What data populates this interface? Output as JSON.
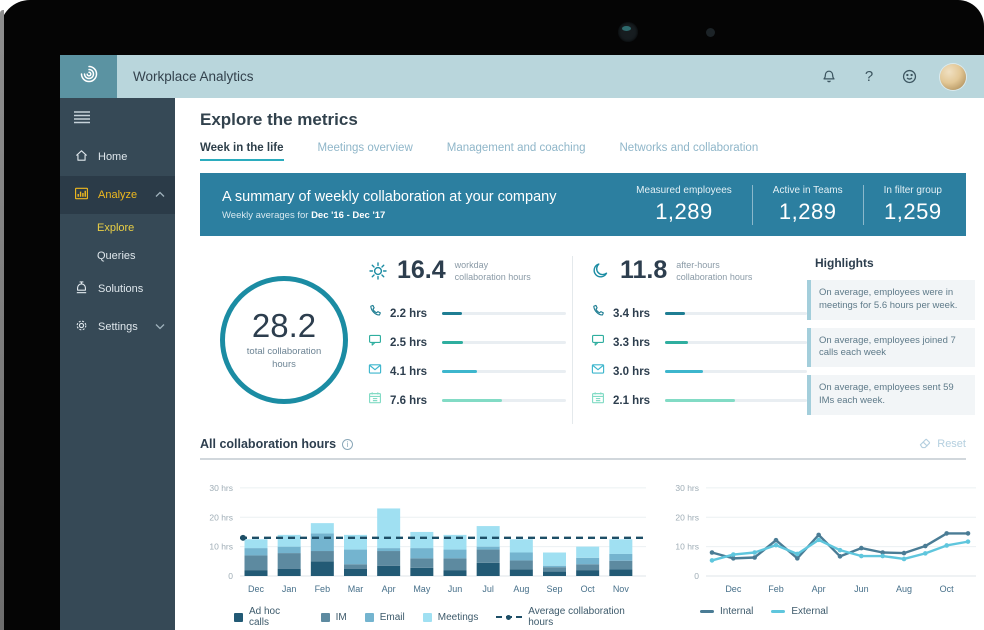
{
  "topbar": {
    "title": "Workplace Analytics",
    "help_label": "?"
  },
  "sidebar": {
    "items": [
      {
        "label": "Home"
      },
      {
        "label": "Analyze"
      },
      {
        "label": "Explore"
      },
      {
        "label": "Queries"
      },
      {
        "label": "Solutions"
      },
      {
        "label": "Settings"
      }
    ],
    "accent_gold": "#efb91f"
  },
  "page": {
    "title": "Explore the metrics",
    "tabs": [
      {
        "label": "Week in the life",
        "active": true
      },
      {
        "label": "Meetings overview",
        "active": false
      },
      {
        "label": "Management and coaching",
        "active": false
      },
      {
        "label": "Networks and collaboration",
        "active": false
      }
    ]
  },
  "banner": {
    "title": "A summary of weekly collaboration at your company",
    "subtitle_prefix": "Weekly averages for",
    "date_range": "Dec '16 - Dec '17",
    "accent": "#2c7fa0",
    "stats": [
      {
        "label": "Measured employees",
        "value": "1,289"
      },
      {
        "label": "Active in Teams",
        "value": "1,289"
      },
      {
        "label": "In filter group",
        "value": "1,259"
      }
    ]
  },
  "summary": {
    "total": {
      "value": "28.2",
      "label": "total collaboration hours"
    },
    "workday": {
      "value": "16.4",
      "label": "workday collaboration hours",
      "rows": [
        {
          "icon": "phone-icon",
          "value": "2.2 hrs",
          "pct": 16,
          "color": "#1f7e93"
        },
        {
          "icon": "im-icon",
          "value": "2.5 hrs",
          "pct": 17,
          "color": "#2fae9f"
        },
        {
          "icon": "email-icon",
          "value": "4.1 hrs",
          "pct": 28,
          "color": "#3db6cd"
        },
        {
          "icon": "meetings-icon",
          "value": "7.6 hrs",
          "pct": 48,
          "color": "#82dbc5"
        }
      ]
    },
    "after_hours": {
      "value": "11.8",
      "label": "after-hours collaboration hours",
      "rows": [
        {
          "icon": "phone-icon",
          "value": "3.4 hrs",
          "pct": 14,
          "color": "#1f7e93"
        },
        {
          "icon": "im-icon",
          "value": "3.3 hrs",
          "pct": 16,
          "color": "#2fae9f"
        },
        {
          "icon": "email-icon",
          "value": "3.0 hrs",
          "pct": 27,
          "color": "#3db6cd"
        },
        {
          "icon": "meetings-icon",
          "value": "2.1 hrs",
          "pct": 49,
          "color": "#82dbc5"
        }
      ]
    }
  },
  "highlights": {
    "title": "Highlights",
    "cards": [
      "On average, employees were in meetings for 5.6 hours per week.",
      "On average, employees joined 7 calls each week",
      "On average, employees sent 59 IMs each week."
    ]
  },
  "section": {
    "title": "All collaboration hours",
    "reset_label": "Reset"
  },
  "chart_data": [
    {
      "type": "bar",
      "stacked": true,
      "title": "All collaboration hours",
      "categories": [
        "Dec",
        "Jan",
        "Feb",
        "Mar",
        "Apr",
        "May",
        "Jun",
        "Jul",
        "Aug",
        "Sep",
        "Oct",
        "Nov"
      ],
      "series": [
        {
          "name": "Ad hoc calls",
          "color": "#225a75",
          "values": [
            2,
            2.5,
            5,
            2.5,
            3.5,
            2.8,
            2,
            4.5,
            2.3,
            1.5,
            2,
            2.2
          ]
        },
        {
          "name": "IM",
          "color": "#5d8aa0",
          "values": [
            5,
            5.3,
            3.5,
            1.5,
            5,
            3.2,
            4,
            4.5,
            3,
            1.5,
            2,
            3
          ]
        },
        {
          "name": "Email",
          "color": "#74b4cf",
          "values": [
            2.5,
            2.2,
            6,
            5,
            1,
            3.5,
            3,
            1,
            2.7,
            0.5,
            2.2,
            2.3
          ]
        },
        {
          "name": "Meetings",
          "color": "#a0e0f2",
          "values": [
            3,
            4,
            3.5,
            5,
            13.5,
            5.5,
            5,
            7,
            4.5,
            4.5,
            3.8,
            5
          ]
        }
      ],
      "average_line": {
        "label": "Average collaboration hours",
        "value": 13,
        "color": "#1d4e66"
      },
      "ylabel": "hrs",
      "ytick_values": [
        0,
        10,
        20,
        30
      ],
      "ytick_labels": [
        "0",
        "10 hrs",
        "20 hrs",
        "30 hrs"
      ],
      "ymax": 32,
      "grid": true,
      "legend_position": "bottom"
    },
    {
      "type": "line",
      "x_labels": [
        "Dec",
        "Feb",
        "Apr",
        "Jun",
        "Aug",
        "Oct"
      ],
      "label_indices": [
        1,
        3,
        5,
        7,
        9,
        11
      ],
      "series": [
        {
          "name": "Internal",
          "color": "#4a7c95",
          "values": [
            8,
            6,
            6.3,
            12.2,
            6,
            14,
            6.7,
            9.5,
            8,
            7.8,
            10.2,
            14.5,
            14.5
          ]
        },
        {
          "name": "External",
          "color": "#5fc6dd",
          "values": [
            5.3,
            7.3,
            8,
            10.5,
            7.5,
            12.3,
            8.8,
            6.8,
            6.8,
            5.8,
            7.7,
            10.4,
            11.7
          ]
        }
      ],
      "ytick_values": [
        0,
        10,
        20,
        30
      ],
      "ytick_labels": [
        "0",
        "10 hrs",
        "20 hrs",
        "30 hrs"
      ],
      "ymax": 32,
      "grid": true,
      "legend_position": "bottom"
    }
  ]
}
